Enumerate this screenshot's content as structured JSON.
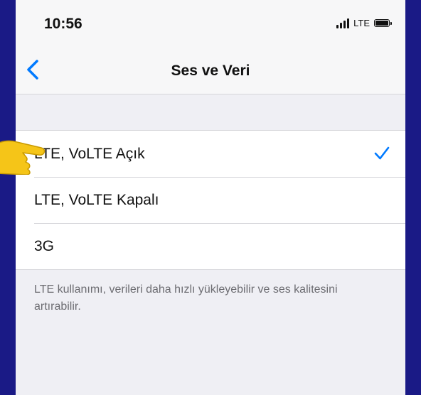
{
  "status_bar": {
    "time": "10:56",
    "network": "LTE"
  },
  "nav": {
    "title": "Ses ve Veri"
  },
  "options": [
    {
      "label": "LTE, VoLTE Açık",
      "selected": true
    },
    {
      "label": "LTE, VoLTE Kapalı",
      "selected": false
    },
    {
      "label": "3G",
      "selected": false
    }
  ],
  "footer_text": "LTE kullanımı, verileri daha hızlı yükleyebilir ve ses kalitesini artırabilir.",
  "colors": {
    "accent": "#007aff",
    "frame": "#1a1a86",
    "pointer": "#f5c518"
  }
}
